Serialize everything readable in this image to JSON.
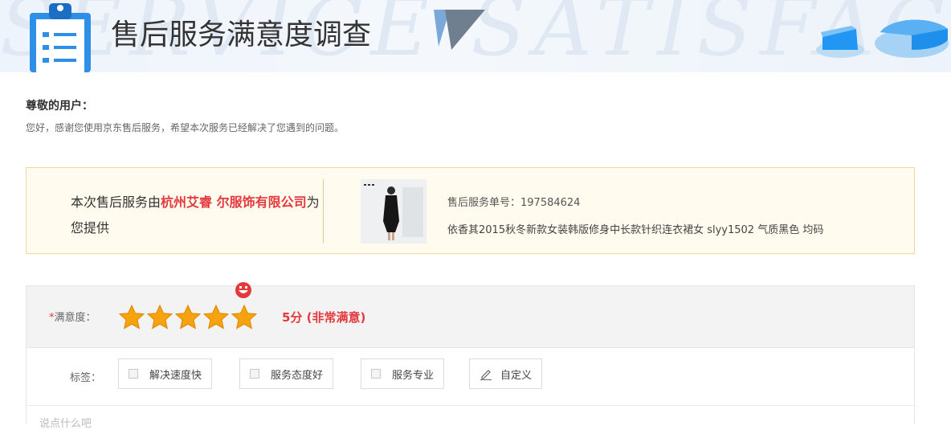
{
  "header": {
    "title": "售后服务满意度调查",
    "watermark": "SERVICE SATISFACTION"
  },
  "greeting": {
    "title": "尊敬的用户：",
    "text": "您好，感谢您使用京东售后服务，希望本次服务已经解决了您遇到的问题。"
  },
  "provider": {
    "prefix": "本次售后服务由",
    "company": "杭州艾睿 尔服饰有限公司",
    "suffix": "为您提供",
    "order_label": "售后服务单号：",
    "order_number": "197584624",
    "product_name": "依香其2015秋冬新款女装韩版修身中长款针织连衣裙女 slyy1502 气质黑色 均码"
  },
  "rating": {
    "required_mark": "*",
    "label": "满意度：",
    "stars_filled": 5,
    "stars_total": 5,
    "score_text": "5分 (非常满意)",
    "star_color": "#f7a20f",
    "accent_color": "#e4393c"
  },
  "tags": {
    "label": "标签：",
    "items": [
      "解决速度快",
      "服务态度好",
      "服务专业"
    ],
    "custom_label": "自定义"
  },
  "comment": {
    "placeholder": "说点什么吧"
  }
}
